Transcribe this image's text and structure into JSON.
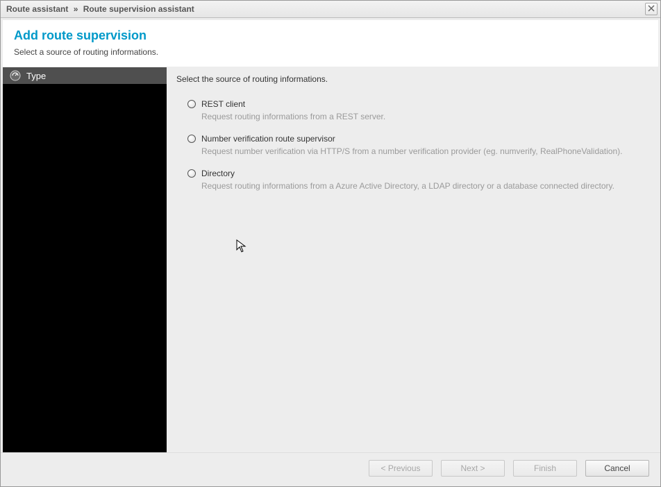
{
  "titlebar": {
    "crumb1": "Route assistant",
    "sep": "»",
    "crumb2": "Route supervision assistant"
  },
  "header": {
    "title": "Add route supervision",
    "subtitle": "Select a source of routing informations."
  },
  "sidebar": {
    "steps": [
      {
        "label": "Type"
      }
    ]
  },
  "content": {
    "prompt": "Select the source of routing informations.",
    "options": [
      {
        "label": "REST client",
        "desc": "Request routing informations from a REST server."
      },
      {
        "label": "Number verification route supervisor",
        "desc": "Request number verification via HTTP/S from a number verification provider (eg. numverify, RealPhoneValidation)."
      },
      {
        "label": "Directory",
        "desc": "Request routing informations from a Azure Active Directory, a LDAP directory or a database connected directory."
      }
    ]
  },
  "footer": {
    "previous": "< Previous",
    "next": "Next >",
    "finish": "Finish",
    "cancel": "Cancel"
  }
}
